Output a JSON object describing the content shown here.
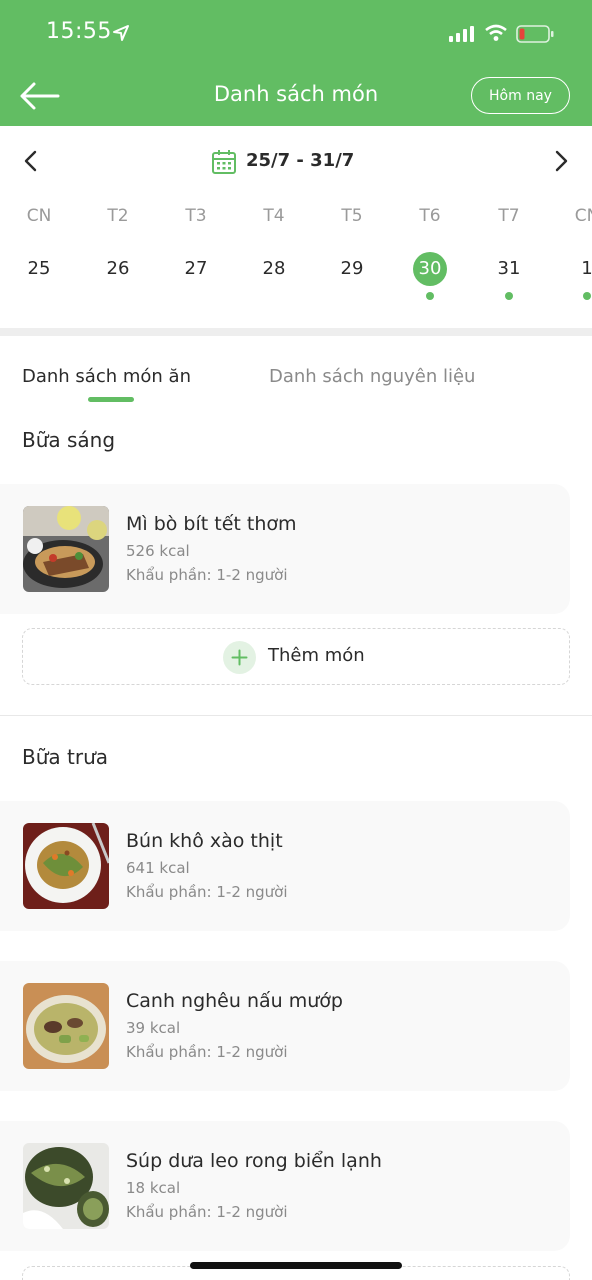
{
  "status_bar": {
    "time": "15:55"
  },
  "header": {
    "title": "Danh sách món",
    "today_label": "Hôm nay",
    "color": "#62bd63"
  },
  "week": {
    "range": "25/7 - 31/7",
    "days": [
      {
        "name": "CN",
        "num": "25",
        "selected": false,
        "dot": false
      },
      {
        "name": "T2",
        "num": "26",
        "selected": false,
        "dot": false
      },
      {
        "name": "T3",
        "num": "27",
        "selected": false,
        "dot": false
      },
      {
        "name": "T4",
        "num": "28",
        "selected": false,
        "dot": false
      },
      {
        "name": "T5",
        "num": "29",
        "selected": false,
        "dot": false
      },
      {
        "name": "T6",
        "num": "30",
        "selected": true,
        "dot": true
      },
      {
        "name": "T7",
        "num": "31",
        "selected": false,
        "dot": true
      },
      {
        "name": "CN",
        "num": "1",
        "selected": false,
        "dot": true
      }
    ]
  },
  "tabs": {
    "food": "Danh sách món ăn",
    "ingredients": "Danh sách nguyên liệu"
  },
  "meals": {
    "breakfast": {
      "title": "Bữa sáng",
      "items": [
        {
          "name": "Mì bò bít tết thơm",
          "kcal": "526 kcal",
          "portion": "Khẩu phần: 1-2 người"
        }
      ],
      "add_label": "Thêm món"
    },
    "lunch": {
      "title": "Bữa trưa",
      "items": [
        {
          "name": "Bún khô xào thịt",
          "kcal": "641 kcal",
          "portion": "Khẩu phần: 1-2 người"
        },
        {
          "name": "Canh nghêu nấu mướp",
          "kcal": "39 kcal",
          "portion": "Khẩu phần: 1-2 người"
        },
        {
          "name": "Súp dưa leo rong biển lạnh",
          "kcal": "18 kcal",
          "portion": "Khẩu phần: 1-2 người"
        }
      ]
    }
  }
}
